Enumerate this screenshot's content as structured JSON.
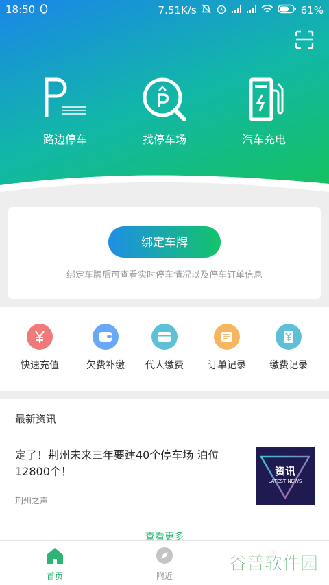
{
  "status_bar": {
    "time": "18:50",
    "speed": "7.51K/s",
    "battery": "61%"
  },
  "features": [
    {
      "label": "路边停车",
      "icon": "parking-p-icon"
    },
    {
      "label": "找停车场",
      "icon": "find-parking-icon"
    },
    {
      "label": "汽车充电",
      "icon": "charging-station-icon"
    }
  ],
  "bind_card": {
    "button": "绑定车牌",
    "tip": "绑定车牌后可查看实时停车情况以及停车订单信息"
  },
  "quick_actions": [
    {
      "label": "快速充值",
      "icon": "yen-icon",
      "color": "#f07a7a"
    },
    {
      "label": "欠费补缴",
      "icon": "wallet-icon",
      "color": "#69a8f7"
    },
    {
      "label": "代人缴费",
      "icon": "card-icon",
      "color": "#5ec0d6"
    },
    {
      "label": "订单记录",
      "icon": "list-icon",
      "color": "#f7b560"
    },
    {
      "label": "缴费记录",
      "icon": "receipt-icon",
      "color": "#5ec0d6"
    }
  ],
  "news": {
    "heading": "最新资讯",
    "item_title": "定了！荆州未来三年要建40个停车场 泊位12800个！",
    "item_source": "荆州之声",
    "thumb_title": "资讯",
    "thumb_sub": "LATEST NEWS",
    "more": "查看更多"
  },
  "tabs": [
    {
      "label": "首页",
      "active": true
    },
    {
      "label": "附近",
      "active": false
    }
  ],
  "watermark": "谷普软件园",
  "colors": {
    "accent": "#2bb673",
    "brand_gradient": [
      "#1a86e8",
      "#16c25a"
    ]
  }
}
